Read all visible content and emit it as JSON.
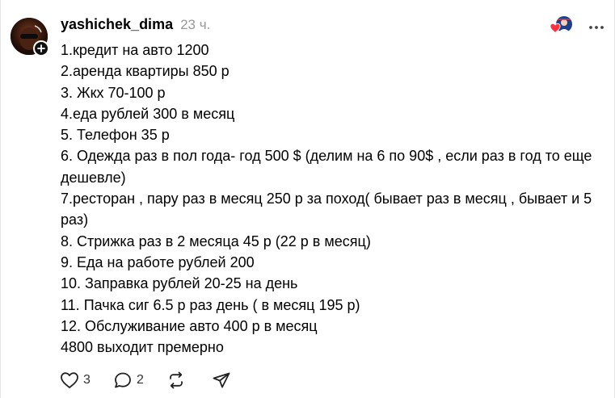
{
  "post": {
    "username": "yashichek_dima",
    "time": "23 ч.",
    "lines": [
      "1.кредит на авто 1200",
      "2.аренда квартиры 850 р",
      "3. Жкх 70-100 р",
      "4.еда рублей 300 в месяц",
      "5. Телефон 35 р",
      "6. Одежда раз в пол года- год 500 $ (делим на 6 по 90$ , если раз в год то еще дешевле)",
      "7.ресторан , пару раз в месяц 250 р за поход( бывает раз в месяц , бывает и 5 раз)",
      "8. Стрижка раз в 2 месяца 45 р (22 р в месяц)",
      "9. Еда на работе рублей 200",
      "10. Заправка рублей 20-25 на день",
      "11. Пачка сиг 6.5 р раз день ( в месяц 195 р)",
      "12. Обслуживание авто 400 р в месяц",
      "4800 выходит премерно"
    ]
  },
  "actions": {
    "likes": "3",
    "replies": "2"
  },
  "icons": {
    "like": "heart-icon",
    "reply": "comment-bubble-icon",
    "repost": "repost-icon",
    "share": "send-icon",
    "more": "more-horizontal-icon",
    "follow": "plus-icon"
  },
  "colors": {
    "text": "#000000",
    "muted": "#999999",
    "reaction_heart": "#ff3040"
  }
}
